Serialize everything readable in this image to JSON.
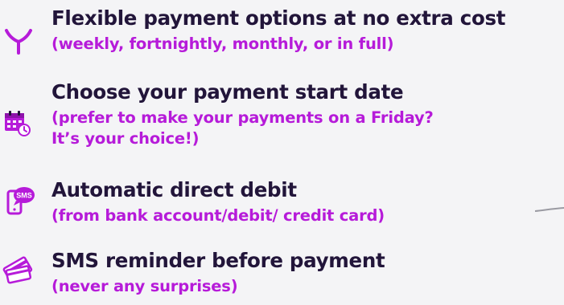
{
  "features": [
    {
      "icon": "fork-split-icon",
      "title": "Flexible payment options at no extra cost",
      "subtitle": "(weekly, fortnightly, monthly, or in full)"
    },
    {
      "icon": "calendar-icon",
      "title": "Choose your payment start date",
      "subtitle": "(prefer to make your payments on a Friday?\nIt’s your choice!)"
    },
    {
      "icon": "sms-phone-icon",
      "title": "Automatic direct debit",
      "subtitle": "(from bank account/debit/ credit card)"
    },
    {
      "icon": "credit-card-icon",
      "title": "SMS reminder before payment",
      "subtitle": "(never any surprises)"
    }
  ],
  "icons": {
    "sms_badge": "SMS"
  },
  "colors": {
    "title": "#22153a",
    "subtitle": "#b61bd9",
    "icon_accent": "#b61bd9",
    "icon_dark": "#22153a",
    "background": "#f4f4f6"
  }
}
